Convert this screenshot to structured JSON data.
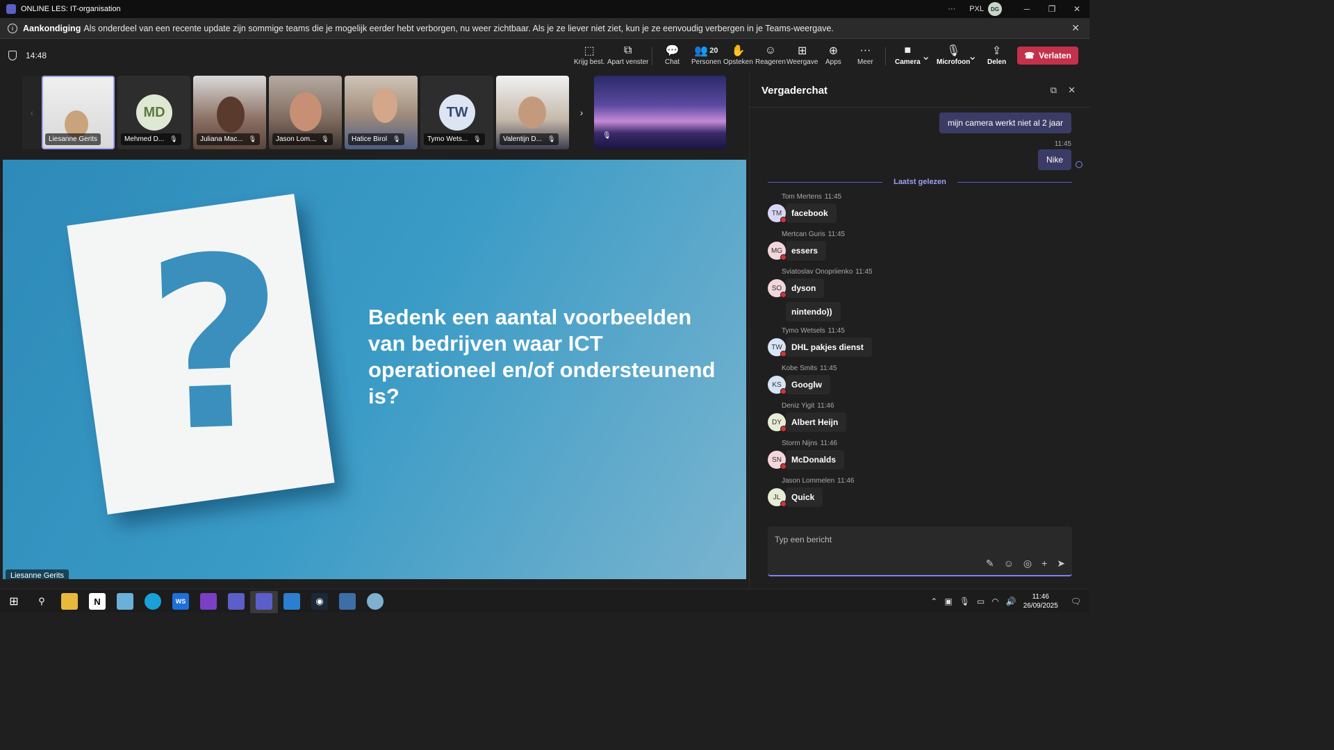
{
  "titlebar": {
    "title": "ONLINE LES: IT-organisation",
    "more": "···",
    "org": "PXL",
    "user_initials": "DG"
  },
  "announcement": {
    "label": "Aankondiging",
    "text": "Als onderdeel van een recente update zijn sommige teams die je mogelijk eerder hebt verborgen, nu weer zichtbaar. Als je ze liever niet ziet, kun je ze eenvoudig verbergen in je Teams-weergave."
  },
  "meeting": {
    "time": "14:48",
    "people_count": "20"
  },
  "toolbar": {
    "krijg_best": "Krijg best.",
    "apart_venster": "Apart venster",
    "chat": "Chat",
    "personen": "Personen",
    "opsteken": "Opsteken",
    "reageren": "Reageren",
    "weergave": "Weergave",
    "apps": "Apps",
    "meer": "Meer",
    "camera": "Camera",
    "microfoon": "Microfoon",
    "delen": "Delen",
    "verlaten": "Verlaten"
  },
  "participants": [
    {
      "name": "Liesanne Gerits"
    },
    {
      "name": "Mehmed D...",
      "initials": "MD"
    },
    {
      "name": "Juliana Mac..."
    },
    {
      "name": "Jason Lom..."
    },
    {
      "name": "Hatice Birol"
    },
    {
      "name": "Tymo Wets...",
      "initials": "TW"
    },
    {
      "name": "Valentijn D..."
    }
  ],
  "slide": {
    "text": "Bedenk een aantal voorbeelden van bedrijven waar ICT operationeel en/of ondersteunend is?",
    "presenter": "Liesanne Gerits"
  },
  "chat": {
    "title": "Vergaderchat",
    "my_messages": [
      {
        "text": "mijn camera werkt niet al 2 jaar"
      },
      {
        "time": "11:45",
        "text": "Nike"
      }
    ],
    "last_read_label": "Laatst gelezen",
    "messages": [
      {
        "author": "Tom Mertens",
        "time": "11:45",
        "initials": "TM",
        "text": "facebook",
        "color": "#d9d6f5"
      },
      {
        "author": "Mertcan Guris",
        "time": "11:45",
        "initials": "MG",
        "text": "essers",
        "color": "#f3d6dc"
      },
      {
        "author": "Sviatoslav Onopriienko",
        "time": "11:45",
        "initials": "SO",
        "text": "dyson",
        "text2": "nintendo))",
        "color": "#f3d6dc"
      },
      {
        "author": "Tymo Wetsels",
        "time": "11:45",
        "initials": "TW",
        "text": "DHL pakjes dienst",
        "color": "#d6e4f5"
      },
      {
        "author": "Kobe Smits",
        "time": "11:45",
        "initials": "KS",
        "text": "Googlw",
        "color": "#d6e4f5"
      },
      {
        "author": "Deniz Yigit",
        "time": "11:46",
        "initials": "DY",
        "text": "Albert Heijn",
        "color": "#e6ecd6"
      },
      {
        "author": "Storm Nijns",
        "time": "11:46",
        "initials": "SN",
        "text": "McDonalds",
        "color": "#f3d6dc"
      },
      {
        "author": "Jason Lommelen",
        "time": "11:46",
        "initials": "JL",
        "text": "Quick",
        "color": "#e6ecd6"
      }
    ],
    "compose_placeholder": "Typ een bericht"
  },
  "taskbar": {
    "clock_time": "11:46",
    "clock_date": "26/09/2025"
  }
}
